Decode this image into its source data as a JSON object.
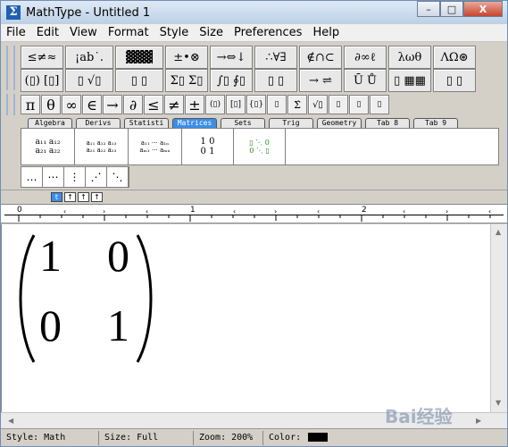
{
  "window": {
    "title": "MathType - Untitled 1",
    "minimize": "–",
    "maximize": "□",
    "close": "X"
  },
  "menu": [
    "File",
    "Edit",
    "View",
    "Format",
    "Style",
    "Size",
    "Preferences",
    "Help"
  ],
  "toolbar": {
    "row1": [
      "≤≠≈",
      "¡ab˙.",
      "▓▓▓",
      "±•⊗",
      "→⇔↓",
      "∴∀∃",
      "∉∩⊂",
      "∂∞ℓ",
      "λωθ",
      "ΛΩ⊛"
    ],
    "row2": [
      "(▯) [▯]",
      "▯ √▯",
      "▯ ▯",
      "Σ▯ Σ▯",
      "∫▯ ∮▯",
      "▯ ▯",
      "→ ⇌",
      "Ū Ů",
      "▯ ▦▦",
      "▯ ▯"
    ],
    "symbols": [
      "π",
      "θ",
      "∞",
      "∈",
      "→",
      "∂",
      "≤",
      "≠",
      "±",
      "(▯)",
      "[▯]",
      "{▯}",
      "▯",
      "Σ̇",
      "√▯",
      "▯",
      "▯",
      "▯"
    ]
  },
  "tabs": {
    "labels": [
      "Algebra",
      "Derivs",
      "Statisti",
      "Matrices",
      "Sets",
      "Trig",
      "Geometry",
      "Tab 8",
      "Tab 9"
    ],
    "active": "Matrices"
  },
  "matrix_templates": [
    {
      "row1": "a₁₁ a₁₂",
      "row2": "a₂₁ a₂₂"
    },
    {
      "row1": "a₁₁ a₁₂ a₁₃",
      "row2": "a₂₁ a₂₂ a₂₃"
    },
    {
      "row1": "a₁₁ ⋯ a₁ₙ",
      "row2": "aₘ₁ ⋯ aₘₙ"
    },
    {
      "row1": "1   0",
      "row2": "0   1"
    },
    {
      "row1": "▯ ⋱ 0",
      "row2": "0 ⋱ ▯"
    }
  ],
  "dots": [
    "…",
    "⋯",
    "⋮",
    "⋰",
    "⋱"
  ],
  "nudge": [
    "t",
    "↑",
    "↑",
    "↑"
  ],
  "ruler": {
    "labels": [
      "0",
      "1",
      "2"
    ]
  },
  "document": {
    "matrix": [
      [
        "1",
        "0"
      ],
      [
        "0",
        "1"
      ]
    ]
  },
  "status": {
    "style": "Style: Math",
    "size": "Size: Full",
    "zoom": "Zoom: 200%",
    "color_label": "Color:",
    "color": "#000000"
  },
  "watermark": "Bai经验"
}
